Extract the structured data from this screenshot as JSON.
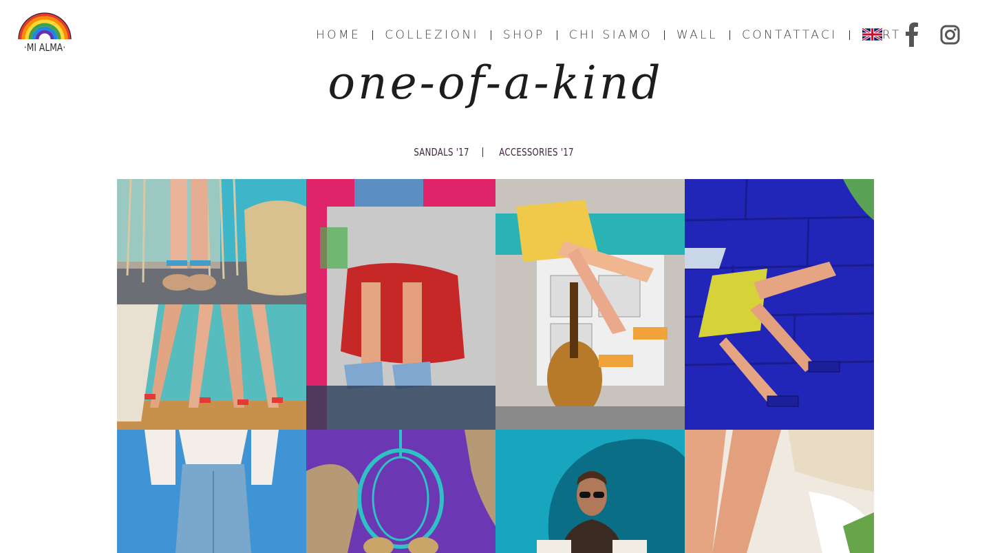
{
  "brand": {
    "name": "·MI ALMA·"
  },
  "nav": {
    "items": [
      {
        "label": "HOME"
      },
      {
        "label": "COLLEZIONI"
      },
      {
        "label": "SHOP"
      },
      {
        "label": "CHI SIAMO"
      },
      {
        "label": "WALL"
      },
      {
        "label": "CONTATTACI"
      },
      {
        "label": "CART"
      }
    ],
    "language_icon": "uk-flag-icon",
    "social": [
      "facebook-icon",
      "instagram-icon"
    ]
  },
  "page": {
    "title": "one-of-a-kind",
    "subnav": [
      {
        "label": "SANDALS '17"
      },
      {
        "label": "ACCESSORIES '17"
      }
    ]
  },
  "gallery": {
    "tiles": [
      {
        "name": "sandals-basket-photo"
      },
      {
        "name": "sandals-red-dress-photo"
      },
      {
        "name": "sandals-guitar-photo"
      },
      {
        "name": "sandals-blue-wall-photo"
      },
      {
        "name": "legs-teal-wall-photo"
      },
      {
        "name": "denim-skirt-photo"
      },
      {
        "name": "birdcage-purple-wall-photo"
      },
      {
        "name": "sunglasses-teal-wall-photo"
      },
      {
        "name": "legs-cream-skirt-photo"
      }
    ]
  },
  "colors": {
    "rainbow": [
      "#e53935",
      "#fb8c00",
      "#fdd835",
      "#43a047",
      "#1e88e5",
      "#5e35b1"
    ]
  }
}
